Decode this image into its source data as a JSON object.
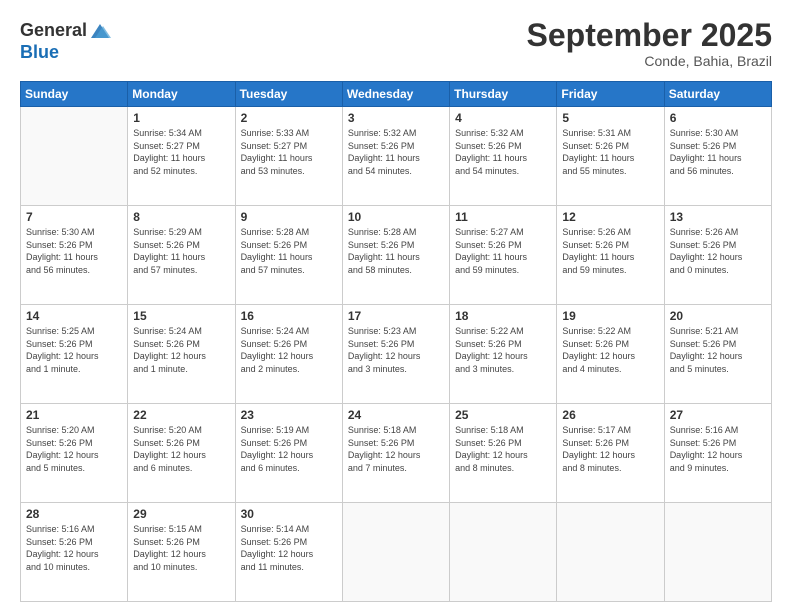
{
  "header": {
    "logo_general": "General",
    "logo_blue": "Blue",
    "month_title": "September 2025",
    "location": "Conde, Bahia, Brazil"
  },
  "days_of_week": [
    "Sunday",
    "Monday",
    "Tuesday",
    "Wednesday",
    "Thursday",
    "Friday",
    "Saturday"
  ],
  "weeks": [
    [
      {
        "day": "",
        "info": ""
      },
      {
        "day": "1",
        "info": "Sunrise: 5:34 AM\nSunset: 5:27 PM\nDaylight: 11 hours\nand 52 minutes."
      },
      {
        "day": "2",
        "info": "Sunrise: 5:33 AM\nSunset: 5:27 PM\nDaylight: 11 hours\nand 53 minutes."
      },
      {
        "day": "3",
        "info": "Sunrise: 5:32 AM\nSunset: 5:26 PM\nDaylight: 11 hours\nand 54 minutes."
      },
      {
        "day": "4",
        "info": "Sunrise: 5:32 AM\nSunset: 5:26 PM\nDaylight: 11 hours\nand 54 minutes."
      },
      {
        "day": "5",
        "info": "Sunrise: 5:31 AM\nSunset: 5:26 PM\nDaylight: 11 hours\nand 55 minutes."
      },
      {
        "day": "6",
        "info": "Sunrise: 5:30 AM\nSunset: 5:26 PM\nDaylight: 11 hours\nand 56 minutes."
      }
    ],
    [
      {
        "day": "7",
        "info": "Sunrise: 5:30 AM\nSunset: 5:26 PM\nDaylight: 11 hours\nand 56 minutes."
      },
      {
        "day": "8",
        "info": "Sunrise: 5:29 AM\nSunset: 5:26 PM\nDaylight: 11 hours\nand 57 minutes."
      },
      {
        "day": "9",
        "info": "Sunrise: 5:28 AM\nSunset: 5:26 PM\nDaylight: 11 hours\nand 57 minutes."
      },
      {
        "day": "10",
        "info": "Sunrise: 5:28 AM\nSunset: 5:26 PM\nDaylight: 11 hours\nand 58 minutes."
      },
      {
        "day": "11",
        "info": "Sunrise: 5:27 AM\nSunset: 5:26 PM\nDaylight: 11 hours\nand 59 minutes."
      },
      {
        "day": "12",
        "info": "Sunrise: 5:26 AM\nSunset: 5:26 PM\nDaylight: 11 hours\nand 59 minutes."
      },
      {
        "day": "13",
        "info": "Sunrise: 5:26 AM\nSunset: 5:26 PM\nDaylight: 12 hours\nand 0 minutes."
      }
    ],
    [
      {
        "day": "14",
        "info": "Sunrise: 5:25 AM\nSunset: 5:26 PM\nDaylight: 12 hours\nand 1 minute."
      },
      {
        "day": "15",
        "info": "Sunrise: 5:24 AM\nSunset: 5:26 PM\nDaylight: 12 hours\nand 1 minute."
      },
      {
        "day": "16",
        "info": "Sunrise: 5:24 AM\nSunset: 5:26 PM\nDaylight: 12 hours\nand 2 minutes."
      },
      {
        "day": "17",
        "info": "Sunrise: 5:23 AM\nSunset: 5:26 PM\nDaylight: 12 hours\nand 3 minutes."
      },
      {
        "day": "18",
        "info": "Sunrise: 5:22 AM\nSunset: 5:26 PM\nDaylight: 12 hours\nand 3 minutes."
      },
      {
        "day": "19",
        "info": "Sunrise: 5:22 AM\nSunset: 5:26 PM\nDaylight: 12 hours\nand 4 minutes."
      },
      {
        "day": "20",
        "info": "Sunrise: 5:21 AM\nSunset: 5:26 PM\nDaylight: 12 hours\nand 5 minutes."
      }
    ],
    [
      {
        "day": "21",
        "info": "Sunrise: 5:20 AM\nSunset: 5:26 PM\nDaylight: 12 hours\nand 5 minutes."
      },
      {
        "day": "22",
        "info": "Sunrise: 5:20 AM\nSunset: 5:26 PM\nDaylight: 12 hours\nand 6 minutes."
      },
      {
        "day": "23",
        "info": "Sunrise: 5:19 AM\nSunset: 5:26 PM\nDaylight: 12 hours\nand 6 minutes."
      },
      {
        "day": "24",
        "info": "Sunrise: 5:18 AM\nSunset: 5:26 PM\nDaylight: 12 hours\nand 7 minutes."
      },
      {
        "day": "25",
        "info": "Sunrise: 5:18 AM\nSunset: 5:26 PM\nDaylight: 12 hours\nand 8 minutes."
      },
      {
        "day": "26",
        "info": "Sunrise: 5:17 AM\nSunset: 5:26 PM\nDaylight: 12 hours\nand 8 minutes."
      },
      {
        "day": "27",
        "info": "Sunrise: 5:16 AM\nSunset: 5:26 PM\nDaylight: 12 hours\nand 9 minutes."
      }
    ],
    [
      {
        "day": "28",
        "info": "Sunrise: 5:16 AM\nSunset: 5:26 PM\nDaylight: 12 hours\nand 10 minutes."
      },
      {
        "day": "29",
        "info": "Sunrise: 5:15 AM\nSunset: 5:26 PM\nDaylight: 12 hours\nand 10 minutes."
      },
      {
        "day": "30",
        "info": "Sunrise: 5:14 AM\nSunset: 5:26 PM\nDaylight: 12 hours\nand 11 minutes."
      },
      {
        "day": "",
        "info": ""
      },
      {
        "day": "",
        "info": ""
      },
      {
        "day": "",
        "info": ""
      },
      {
        "day": "",
        "info": ""
      }
    ]
  ]
}
